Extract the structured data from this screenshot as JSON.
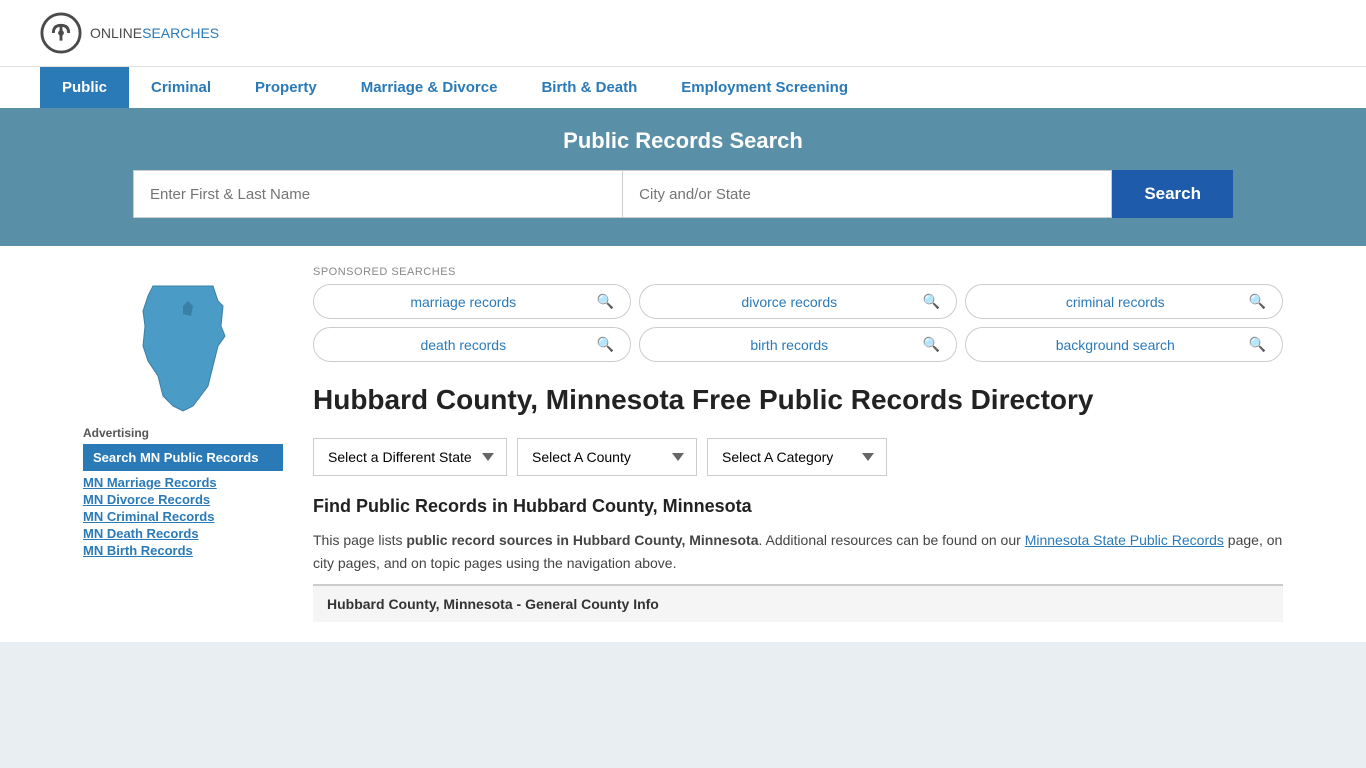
{
  "logo": {
    "online": "ONLINE",
    "searches": "SEARCHES"
  },
  "nav": {
    "items": [
      {
        "label": "Public",
        "active": true
      },
      {
        "label": "Criminal",
        "active": false
      },
      {
        "label": "Property",
        "active": false
      },
      {
        "label": "Marriage & Divorce",
        "active": false
      },
      {
        "label": "Birth & Death",
        "active": false
      },
      {
        "label": "Employment Screening",
        "active": false
      }
    ]
  },
  "search_banner": {
    "title": "Public Records Search",
    "name_placeholder": "Enter First & Last Name",
    "location_placeholder": "City and/or State",
    "button_label": "Search"
  },
  "sponsored": {
    "label": "SPONSORED SEARCHES",
    "items": [
      {
        "text": "marriage records"
      },
      {
        "text": "divorce records"
      },
      {
        "text": "criminal records"
      },
      {
        "text": "death records"
      },
      {
        "text": "birth records"
      },
      {
        "text": "background search"
      }
    ]
  },
  "page_title": "Hubbard County, Minnesota Free Public Records Directory",
  "dropdowns": {
    "state_label": "Select a Different State",
    "county_label": "Select A County",
    "category_label": "Select A Category"
  },
  "find_section": {
    "title": "Find Public Records in Hubbard County, Minnesota",
    "text_before": "This page lists ",
    "text_bold": "public record sources in Hubbard County, Minnesota",
    "text_after": ". Additional resources can be found on our ",
    "link_text": "Minnesota State Public Records",
    "text_end": " page, on city pages, and on topic pages using the navigation above."
  },
  "county_info_header": "Hubbard County, Minnesota - General County Info",
  "sidebar": {
    "advertising_label": "Advertising",
    "highlight_label": "Search MN Public Records",
    "links": [
      {
        "text": "MN Marriage Records"
      },
      {
        "text": "MN Divorce Records"
      },
      {
        "text": "MN Criminal Records"
      },
      {
        "text": "MN Death Records"
      },
      {
        "text": "MN Birth Records"
      }
    ]
  }
}
